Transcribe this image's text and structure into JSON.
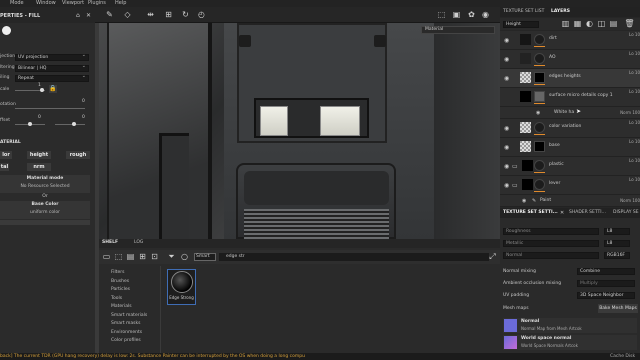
{
  "menubar": {
    "items": [
      "Mode",
      "Window",
      "Viewport",
      "Plugins",
      "Help"
    ]
  },
  "left_panel": {
    "title": "PERTIES - FILL",
    "projection_label": "jection",
    "projection_value": "UV projection",
    "filtering_label": "ltering",
    "filtering_value": "Bilinear | HQ",
    "tiling_label": "iling",
    "tiling_value": "Repeat",
    "scale_label": "cale",
    "scale_value": "1",
    "rotation_label": "otation",
    "rotation_value": "0",
    "offset_label": "ffset",
    "offset_value_1": "0",
    "offset_value_2": "0",
    "chips": [
      "lor",
      "height",
      "rough",
      "tal",
      "nrm"
    ],
    "material_header": "ATERIAL",
    "material_mode_label": "Material mode",
    "material_mode_value": "No Resource Selected",
    "or_label": "Or",
    "base_color_label": "Base Color",
    "base_color_value": "uniform color"
  },
  "viewport": {
    "material_select": "Material"
  },
  "shelf": {
    "tabs": [
      "SHELF",
      "LOG"
    ],
    "filter_chip": "Smart",
    "search_value": "edge str",
    "categories": [
      "Filters",
      "Brushes",
      "Particles",
      "Tools",
      "Materials",
      "Smart materials",
      "Smart masks",
      "Environments",
      "Color profiles"
    ],
    "item_label": "Edge Strong"
  },
  "right_panel": {
    "tabs": [
      "TEXTURE SET LIST",
      "LAYERS"
    ],
    "channel_select": "Height",
    "layers": [
      {
        "name": "dirt",
        "right": "Lo 10"
      },
      {
        "name": "AO",
        "right": "Lo 10"
      },
      {
        "name": "edges heights",
        "right": "Lo 10"
      },
      {
        "name": "surface micro details copy 1",
        "right": "Lo 10"
      },
      {
        "name": "White ha",
        "right": "Norm 100"
      },
      {
        "name": "color variation",
        "right": "Lo 10"
      },
      {
        "name": "base",
        "right": "Lo 10"
      },
      {
        "name": "plastic",
        "right": "Lo 10"
      },
      {
        "name": "lever",
        "right": "Lo 10"
      },
      {
        "name": "Paint",
        "right": "Norm 100"
      }
    ],
    "settings_tabs": [
      "TEXTURE SET SETTI...",
      "SHADER SETTI...",
      "DISPLAY SE"
    ],
    "roughness_label": "Roughness",
    "roughness_value": "L8",
    "metallic_label": "Metallic",
    "metallic_value": "L8",
    "normal_label": "Normal",
    "normal_value": "RGB16F",
    "normal_mixing_label": "Normal mixing",
    "normal_mixing_value": "Combine",
    "ao_mixing_label": "Ambient occlusion mixing",
    "ao_mixing_value": "Multiply",
    "uv_padding_label": "UV padding",
    "uv_padding_value": "3D Space Neighbor",
    "mesh_maps_label": "Mesh maps",
    "bake_button": "Bake Mesh Maps",
    "maps": [
      {
        "title": "Normal",
        "subtitle": "Normal Map from Mesh Artcok"
      },
      {
        "title": "World space normal",
        "subtitle": "World Space Normals Artcok"
      }
    ]
  },
  "statusbar": {
    "message": "back] The current TDR (GPU hang recovery) delay is low: 2s. Substance Painter can be interrupted by the OS when doing a long compu",
    "right": "Cache Disk"
  },
  "colors": {
    "orange": "#e08a2c",
    "status_text": "#d7a13b",
    "map_thumb": "#6b6bd9"
  }
}
